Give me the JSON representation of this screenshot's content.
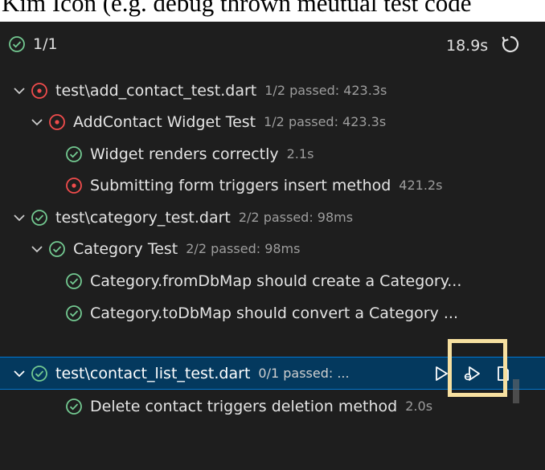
{
  "caption_text": "Kim Icon (e.g. debug thrown meutual test code",
  "summary": {
    "count": "1/1",
    "duration": "18.9s"
  },
  "colors": {
    "pass": "#73c991",
    "fail": "#f14c4c",
    "selection": "#04395e",
    "highlight": "#f7e0a0"
  },
  "tree": {
    "rows": [
      {
        "name": "test\\add_contact_test.dart",
        "meta": "1/2 passed: 423.3s"
      },
      {
        "name": "AddContact Widget Test",
        "meta": "1/2 passed: 423.3s"
      },
      {
        "name": "Widget renders correctly",
        "meta": "2.1s"
      },
      {
        "name": "Submitting form triggers insert method",
        "meta": "421.2s"
      },
      {
        "name": "test\\category_test.dart",
        "meta": "2/2 passed: 98ms"
      },
      {
        "name": "Category Test",
        "meta": "2/2 passed: 98ms"
      },
      {
        "name": "Category.fromDbMap should create a Category..."
      },
      {
        "name": "Category.toDbMap should convert a Category ..."
      },
      {
        "name": "test\\contact_list_test.dart",
        "meta": "0/1 passed: ..."
      },
      {
        "name": "Delete contact triggers deletion method",
        "meta": "2.0s"
      }
    ]
  },
  "icons": {
    "pass": "check-circle-icon",
    "fail": "error-circle-icon",
    "expand": "chevron-down-icon",
    "refresh": "refresh-icon",
    "run": "run-test-icon",
    "debug": "debug-test-icon",
    "open": "go-to-file-icon"
  }
}
